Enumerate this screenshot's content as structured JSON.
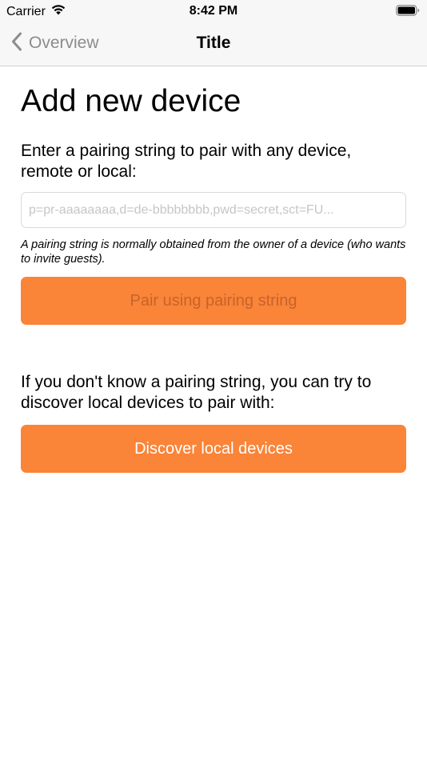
{
  "status_bar": {
    "carrier": "Carrier",
    "time": "8:42 PM"
  },
  "nav": {
    "back_label": "Overview",
    "title": "Title"
  },
  "main": {
    "page_title": "Add new device",
    "instructions": "Enter a pairing string to pair with any device, remote or local:",
    "pairing_input": {
      "value": "",
      "placeholder": "p=pr-aaaaaaaa,d=de-bbbbbbbb,pwd=secret,sct=FU..."
    },
    "hint": "A pairing string is normally obtained from the owner of a device (who wants to invite guests).",
    "pair_button_label": "Pair using pairing string",
    "discover_text": "If you don't know a pairing string, you can try to discover local devices to pair with:",
    "discover_button_label": "Discover local devices"
  },
  "colors": {
    "accent": "#fa8438",
    "nav_background": "#f7f7f7",
    "back_text": "#8c8c8c",
    "placeholder": "#c6c6c9"
  },
  "icons": {
    "wifi": "wifi-icon",
    "battery": "battery-icon",
    "back": "chevron-left-icon"
  }
}
